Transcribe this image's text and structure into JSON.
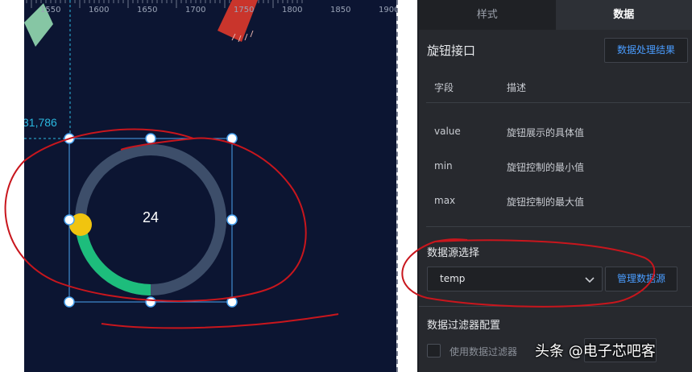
{
  "canvas": {
    "ruler_ticks": [
      "1550",
      "1600",
      "1650",
      "1700",
      "1750",
      "1800",
      "1850",
      "1900"
    ],
    "coordinate_text": "31,786",
    "knob": {
      "value_text": "24",
      "track_color": "#3d4e6a",
      "progress_color": "#1dbd7c",
      "handle_color": "#f1c40f",
      "selection_color": "#4aa3f0"
    }
  },
  "panel": {
    "tabs": [
      {
        "label": "样式"
      },
      {
        "label": "数据"
      }
    ],
    "interface_title": "旋钮接口",
    "result_button": "数据处理结果",
    "table": {
      "headers": [
        "字段",
        "描述"
      ],
      "rows": [
        {
          "field": "value",
          "desc": "旋钮展示的具体值"
        },
        {
          "field": "min",
          "desc": "旋钮控制的最小值"
        },
        {
          "field": "max",
          "desc": "旋钮控制的最大值"
        }
      ]
    },
    "data_source": {
      "label": "数据源选择",
      "selected": "temp",
      "manage_button": "管理数据源"
    },
    "filter": {
      "section_label": "数据过滤器配置",
      "checkbox_label": "使用数据过滤器"
    }
  },
  "watermark": "头条 @电子芯吧客"
}
